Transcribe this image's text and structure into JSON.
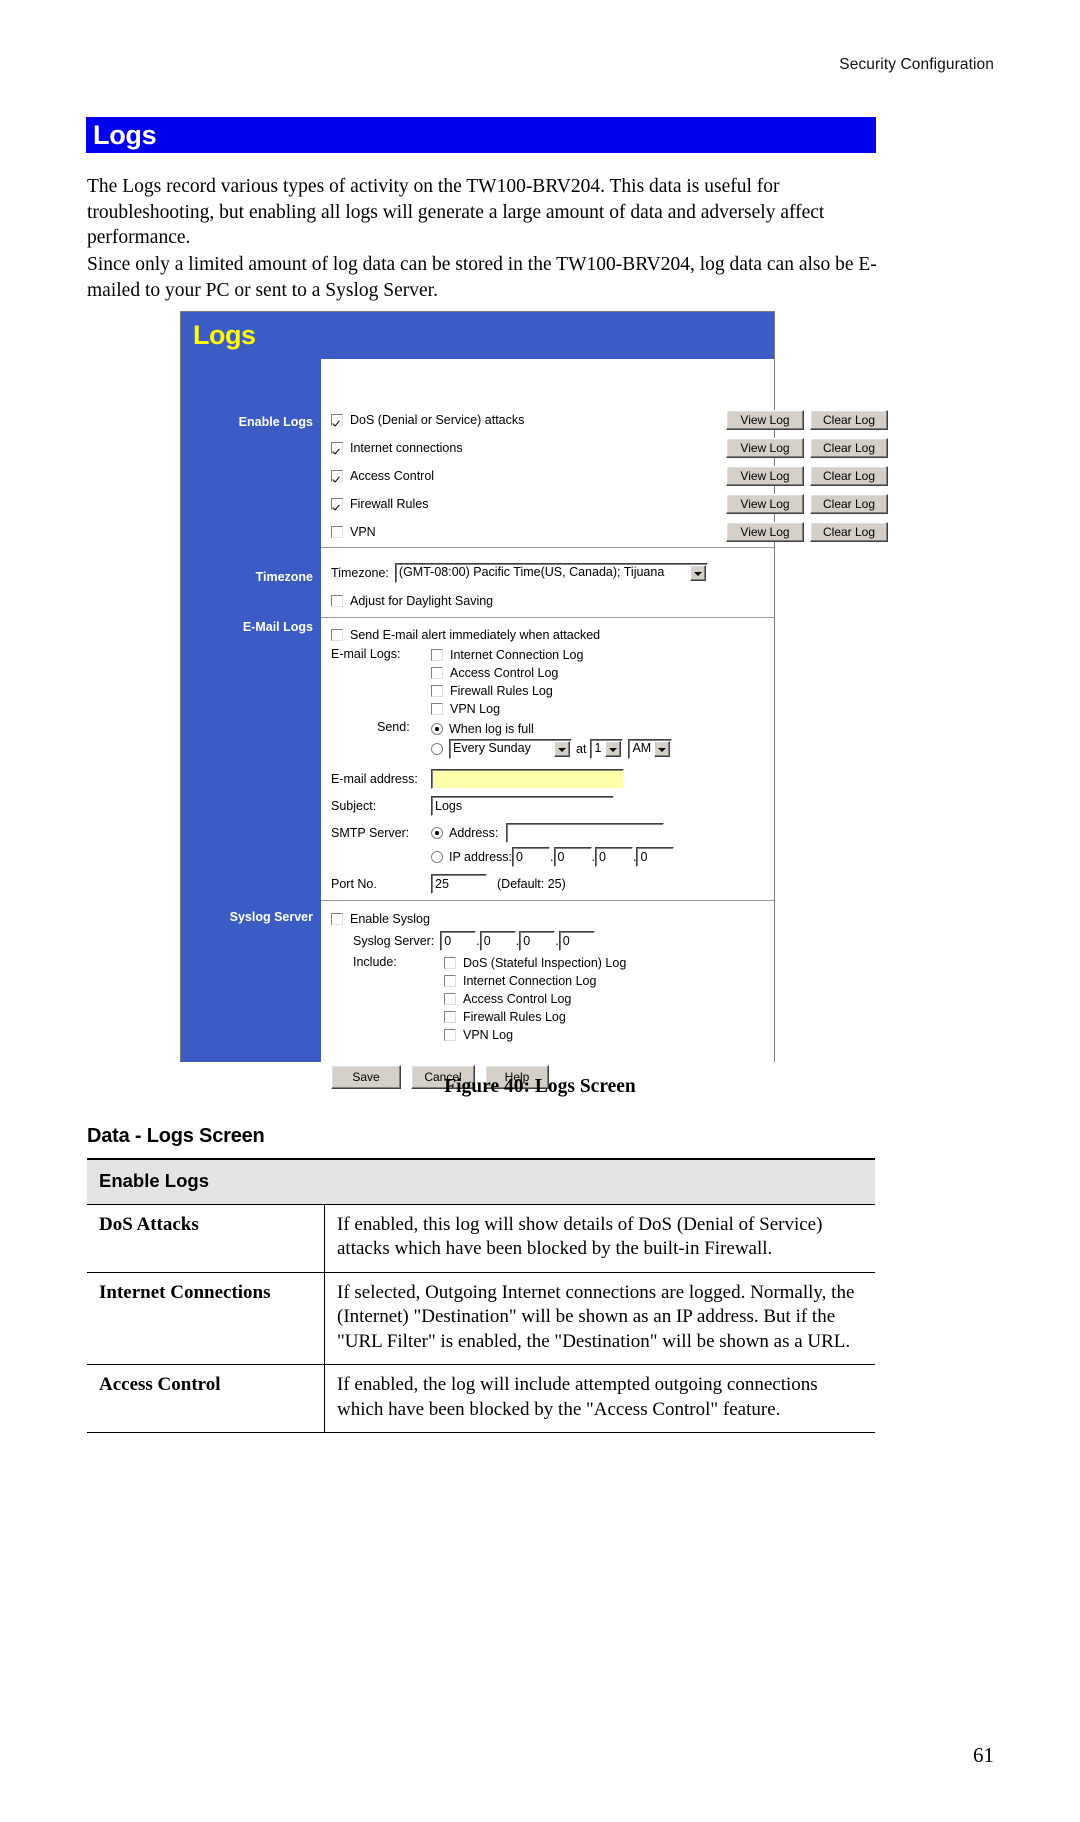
{
  "page": {
    "running_header": "Security Configuration",
    "page_number": "61",
    "banner_title": "Logs",
    "paragraph_1": "The Logs record various types of activity on the TW100-BRV204. This data is useful for troubleshooting, but enabling all logs will generate a large amount of data and adversely affect performance.",
    "paragraph_2": "Since only a limited amount of log data can be stored in the TW100-BRV204, log data can also be E-mailed to your PC or sent to a Syslog Server.",
    "figure_caption": "Figure 40: Logs Screen",
    "section_title": "Data - Logs Screen"
  },
  "screenshot": {
    "logo": "Logs",
    "side_labels": {
      "enable_logs": "Enable Logs",
      "timezone": "Timezone",
      "email_logs": "E-Mail Logs",
      "syslog_server": "Syslog Server"
    },
    "enable_logs_rows": [
      {
        "label": "DoS (Denial or Service) attacks",
        "checked": true,
        "view": "View Log",
        "clear": "Clear Log"
      },
      {
        "label": "Internet connections",
        "checked": true,
        "view": "View Log",
        "clear": "Clear Log"
      },
      {
        "label": "Access Control",
        "checked": true,
        "view": "View Log",
        "clear": "Clear Log"
      },
      {
        "label": "Firewall Rules",
        "checked": true,
        "view": "View Log",
        "clear": "Clear Log"
      },
      {
        "label": "VPN",
        "checked": false,
        "view": "View Log",
        "clear": "Clear Log"
      }
    ],
    "timezone": {
      "label": "Timezone:",
      "value": "(GMT-08:00) Pacific Time(US, Canada); Tijuana",
      "daylight_label": "Adjust for Daylight Saving",
      "daylight_checked": false
    },
    "email": {
      "alert_label": "Send E-mail alert immediately when attacked",
      "alert_checked": false,
      "logs_label": "E-mail Logs:",
      "log_items": [
        {
          "label": "Internet Connection Log",
          "checked": false
        },
        {
          "label": "Access Control Log",
          "checked": false
        },
        {
          "label": "Firewall Rules Log",
          "checked": false
        },
        {
          "label": "VPN Log",
          "checked": false
        }
      ],
      "send_label": "Send:",
      "send_option_full": "When log is full",
      "send_full_selected": true,
      "send_schedule_selected": false,
      "schedule_value": "Every Sunday",
      "at_label": "at",
      "hour_value": "1",
      "ampm_value": "AM",
      "address_label": "E-mail address:",
      "address_value": "",
      "subject_label": "Subject:",
      "subject_value": "Logs",
      "smtp_label": "SMTP Server:",
      "smtp_address_label": "Address:",
      "smtp_address_value": "",
      "smtp_address_selected": true,
      "smtp_ip_label": "IP address:",
      "smtp_ip_selected": false,
      "smtp_ip_octets": [
        "0",
        "0",
        "0",
        "0"
      ],
      "port_label": "Port No.",
      "port_value": "25",
      "port_default": "(Default: 25)"
    },
    "syslog": {
      "enable_label": "Enable Syslog",
      "enable_checked": false,
      "server_label": "Syslog Server:",
      "server_octets": [
        "0",
        "0",
        "0",
        "0"
      ],
      "include_label": "Include:",
      "include_items": [
        {
          "label": "DoS (Stateful Inspection) Log",
          "checked": false
        },
        {
          "label": "Internet Connection Log",
          "checked": false
        },
        {
          "label": "Access Control Log",
          "checked": false
        },
        {
          "label": "Firewall Rules Log",
          "checked": false
        },
        {
          "label": "VPN Log",
          "checked": false
        }
      ]
    },
    "buttons": {
      "save": "Save",
      "cancel": "Cancel",
      "help": "Help"
    }
  },
  "data_table": {
    "header": "Enable Logs",
    "rows": [
      {
        "name": "DoS Attacks",
        "desc": "If enabled, this log will show details of DoS (Denial of Service) attacks which have been blocked by the built-in Firewall."
      },
      {
        "name": "Internet Connections",
        "desc": "If selected, Outgoing Internet connections are logged. Normally, the (Internet) \"Destination\" will be shown as an IP address. But if the \"URL Filter\" is enabled, the \"Destination\" will be shown as a URL."
      },
      {
        "name": "Access Control",
        "desc": "If enabled, the log will include attempted outgoing connections which have been blocked by the \"Access Control\" feature."
      }
    ]
  },
  "colors": {
    "banner_blue": "#0000ee",
    "panel_blue": "#3b5cc4",
    "logo_yellow": "#ffff00",
    "field_highlight": "#ffffaa",
    "button_face": "#d4d0c8"
  }
}
